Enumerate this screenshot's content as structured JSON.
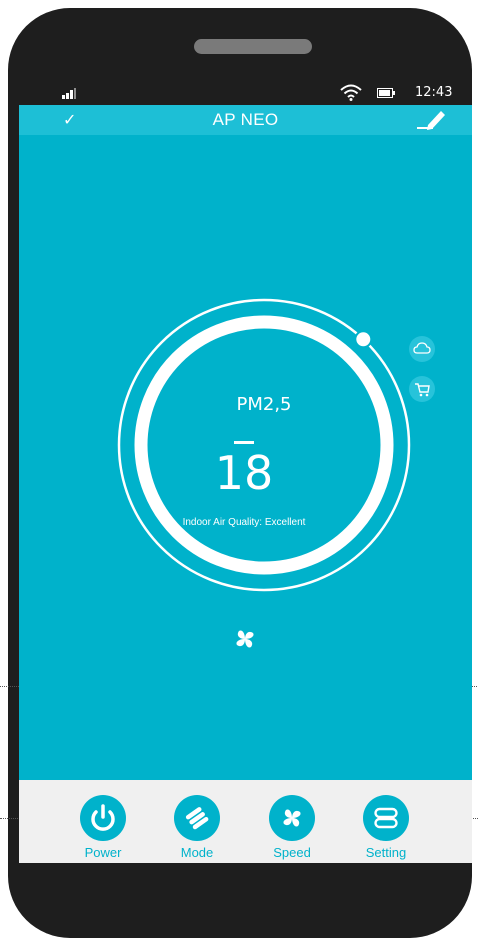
{
  "status_bar": {
    "time": "12:43"
  },
  "app_bar": {
    "title": "AP NEO"
  },
  "gauge": {
    "metric_label": "PM2,5",
    "value": "18",
    "quality_text": "Indoor Air Quality: Excellent",
    "level": 0.97
  },
  "side_icons": [
    "cloud-icon",
    "cart-icon"
  ],
  "tabs": [
    {
      "label": "Power",
      "icon": "power-icon"
    },
    {
      "label": "Mode",
      "icon": "mode-icon"
    },
    {
      "label": "Speed",
      "icon": "fan-icon"
    },
    {
      "label": "Setting",
      "icon": "setting-icon"
    }
  ],
  "colors": {
    "accent": "#00b2cb",
    "appbar": "#1dbfd6",
    "tabbar": "#f0f0f0",
    "phone_body": "#1e1e1e"
  }
}
